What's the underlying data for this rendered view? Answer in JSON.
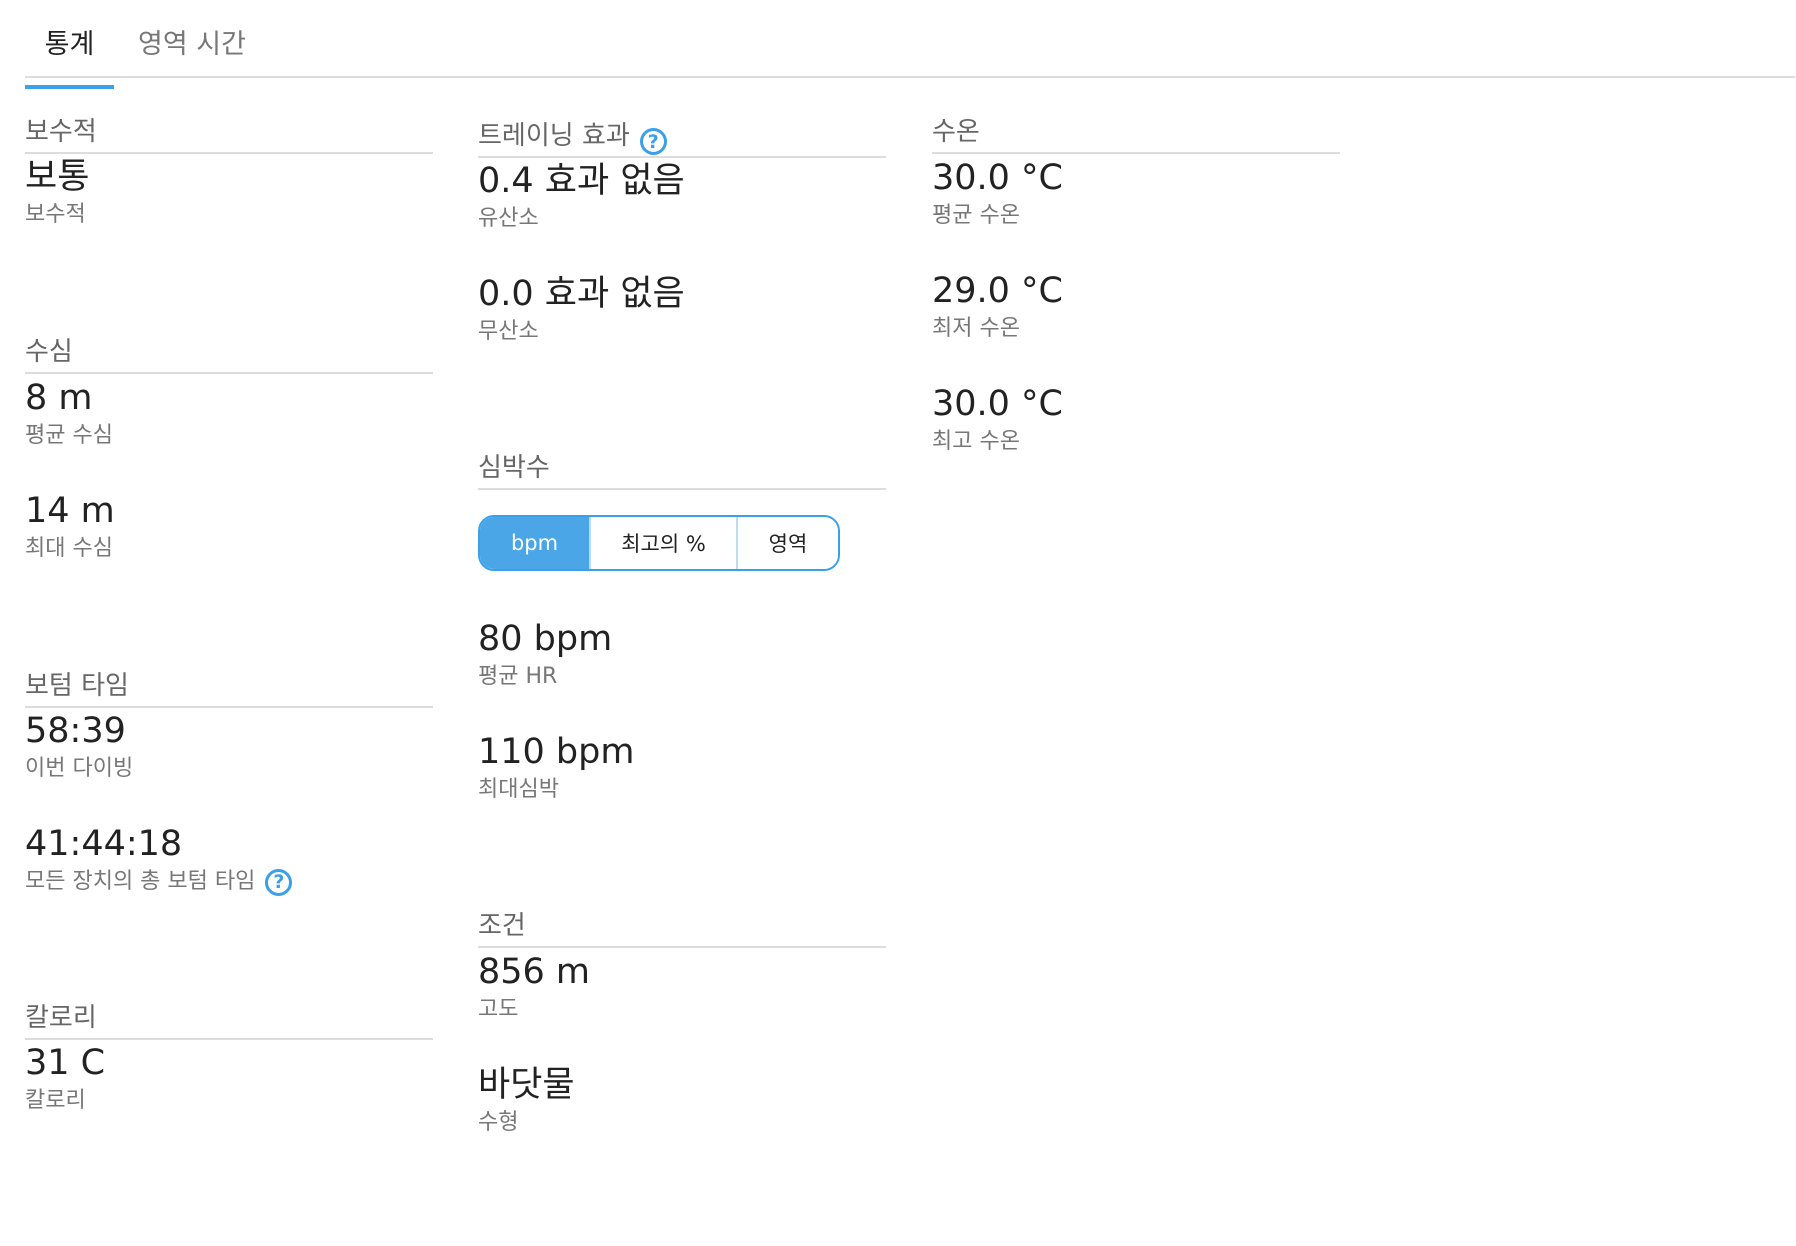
{
  "tabs": [
    {
      "label": "통계",
      "active": true
    },
    {
      "label": "영역 시간",
      "active": false
    }
  ],
  "accent_color": "#3aa0e8",
  "conservatism": {
    "title": "보수적",
    "value": "보통",
    "label": "보수적"
  },
  "depth": {
    "title": "수심",
    "avg_value": "8 m",
    "avg_label": "평균 수심",
    "max_value": "14 m",
    "max_label": "최대 수심"
  },
  "bottom_time": {
    "title": "보텀 타임",
    "dive_value": "58:39",
    "dive_label": "이번 다이빙",
    "total_value": "41:44:18",
    "total_label": "모든 장치의 총 보텀 타임",
    "help_icon": "?"
  },
  "calories": {
    "title": "칼로리",
    "value": "31 C",
    "label": "칼로리"
  },
  "training_effect": {
    "title": "트레이닝 효과",
    "help_icon": "?",
    "aerobic_value": "0.4 효과 없음",
    "aerobic_label": "유산소",
    "anaerobic_value": "0.0 효과 없음",
    "anaerobic_label": "무산소"
  },
  "heart_rate": {
    "title": "심박수",
    "toggle": {
      "options": [
        "bpm",
        "최고의 %",
        "영역"
      ],
      "selected": "bpm"
    },
    "avg_value": "80 bpm",
    "avg_label": "평균 HR",
    "max_value": "110 bpm",
    "max_label": "최대심박"
  },
  "conditions": {
    "title": "조건",
    "altitude_value": "856 m",
    "altitude_label": "고도",
    "water_type_value": "바닷물",
    "water_type_label": "수형"
  },
  "water_temp": {
    "title": "수온",
    "avg_value": "30.0 °C",
    "avg_label": "평균 수온",
    "min_value": "29.0 °C",
    "min_label": "최저 수온",
    "max_value": "30.0 °C",
    "max_label": "최고 수온"
  }
}
